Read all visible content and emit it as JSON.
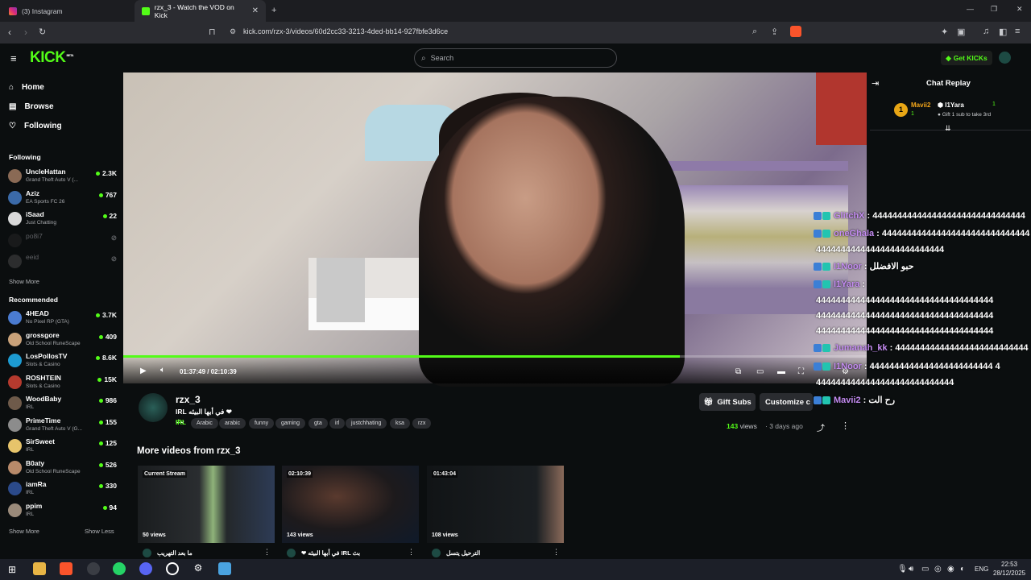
{
  "browser": {
    "tabs": [
      {
        "title": "(3) Instagram",
        "icon": "instagram-icon",
        "active": false
      },
      {
        "title": "rzx_3 - Watch the VOD on Kick",
        "icon": "kick-icon",
        "active": true
      }
    ],
    "url": "kick.com/rzx-3/videos/60d2cc33-3213-4ded-bb14-927fbfe3d6ce"
  },
  "header": {
    "logo": "KICK",
    "logo_badge": "BETA",
    "search_placeholder": "Search",
    "get_kicks": "Get KICKs"
  },
  "sidebar": {
    "nav": [
      {
        "label": "Home",
        "icon": "home-icon"
      },
      {
        "label": "Browse",
        "icon": "browse-icon"
      },
      {
        "label": "Following",
        "icon": "heart-icon"
      }
    ],
    "following_title": "Following",
    "following": [
      {
        "name": "UncleHattan",
        "game": "Grand Theft Auto V (...",
        "count": "2.3K",
        "color": "#8a6a55"
      },
      {
        "name": "Aziz",
        "game": "EA Sports FC 26",
        "count": "767",
        "color": "#3b6aa8"
      },
      {
        "name": "iSaad",
        "game": "Just Chatting",
        "count": "22",
        "color": "#d9d9d9"
      },
      {
        "name": "po8i7",
        "game": "",
        "count": "",
        "color": "#2a2a2a",
        "offline": true
      },
      {
        "name": "eeid",
        "game": "",
        "count": "",
        "color": "#555555",
        "offline": true
      }
    ],
    "show_more_following": "Show More",
    "recommended_title": "Recommended",
    "recommended": [
      {
        "name": "4HEAD",
        "game": "No Pixel RP (GTA)",
        "count": "3.7K",
        "color": "#4a7bd0"
      },
      {
        "name": "grossgore",
        "game": "Old School RuneScape",
        "count": "409",
        "color": "#c9a27a"
      },
      {
        "name": "LosPollosTV",
        "game": "Slots & Casino",
        "count": "8.6K",
        "color": "#1d9bd1"
      },
      {
        "name": "ROSHTEIN",
        "game": "Slots & Casino",
        "count": "15K",
        "color": "#b53a2e"
      },
      {
        "name": "WoodBaby",
        "game": "IRL",
        "count": "986",
        "color": "#6e5a4a"
      },
      {
        "name": "PrimeTime",
        "game": "Grand Theft Auto V (G...",
        "count": "155",
        "color": "#8c8c8c"
      },
      {
        "name": "SirSweet",
        "game": "IRL",
        "count": "125",
        "color": "#e7c46b"
      },
      {
        "name": "B0aty",
        "game": "Old School RuneScape",
        "count": "526",
        "color": "#b88a6a"
      },
      {
        "name": "iamRa",
        "game": "IRL",
        "count": "330",
        "color": "#2b4a8a"
      },
      {
        "name": "ppim",
        "game": "IRL",
        "count": "94",
        "color": "#9a8a7a"
      }
    ],
    "show_more": "Show More",
    "show_less": "Show Less"
  },
  "player": {
    "current_time": "01:37:49",
    "separator": "/",
    "duration": "02:10:39",
    "progress": 0.749
  },
  "chat": {
    "title": "Chat Replay",
    "pinned_left_name": "Mavii2",
    "pinned_left_count": "1",
    "pinned_right_name": "I1Yara",
    "pinned_right_count": "1",
    "pinned_sub": "Gift 1 sub to take 3rd",
    "messages": [
      {
        "user": "GlitchX",
        "text": ": 4444444444444444444444444444444"
      },
      {
        "user": "oneGhala",
        "text": ": 444444444444444444444444444444"
      },
      {
        "user": "",
        "text": "44444444444444444444444444"
      },
      {
        "user": "I1Noor",
        "text": ": حبو الافضلل"
      },
      {
        "user": "I1Yara",
        "text": ":"
      },
      {
        "user": "",
        "text": "444444444444444444444444444444444444"
      },
      {
        "user": "",
        "text": "444444444444444444444444444444444444"
      },
      {
        "user": "",
        "text": "444444444444444444444444444444444444"
      },
      {
        "user": "",
        "text": "444444444444444444444444444444444444"
      },
      {
        "user": "Jumanah_kk",
        "text": ": 444444444444444444444444444"
      },
      {
        "user": "I1Noor",
        "text": ": 4444444444444444444444444 4"
      },
      {
        "user": "",
        "text": "4444444444444444444444444444"
      },
      {
        "user": "Mavii2",
        "text": ": رح الت"
      }
    ]
  },
  "stream": {
    "channel": "rzx_3",
    "title": "❤ في أبها البيئه IRL بث",
    "category": "IRL",
    "tags": [
      "Arabic",
      "arabic",
      "funny",
      "gaming",
      "gta",
      "irl",
      "justchhating",
      "ksa",
      "rzx"
    ],
    "views": "143",
    "views_label": "views",
    "age": "3 days ago",
    "gift_subs": "Gift Subs",
    "customize": "Customize c"
  },
  "more_videos": {
    "title": "More videos from rzx_3",
    "cards": [
      {
        "badge": "Current Stream",
        "views": "50 views",
        "title": "ما بعد التهريب"
      },
      {
        "badge": "02:10:39",
        "views": "143 views",
        "title": "❤ في أبها البيئه IRL بث"
      },
      {
        "badge": "01:43:04",
        "views": "108 views",
        "title": "الترحيل يتسل"
      }
    ]
  },
  "taskbar": {
    "lang": "ENG",
    "time": "22:53",
    "date": "28/12/2025"
  },
  "colors": {
    "accent": "#53fc18",
    "background": "#0b0e0f",
    "chat_user": "#c48cf2"
  }
}
